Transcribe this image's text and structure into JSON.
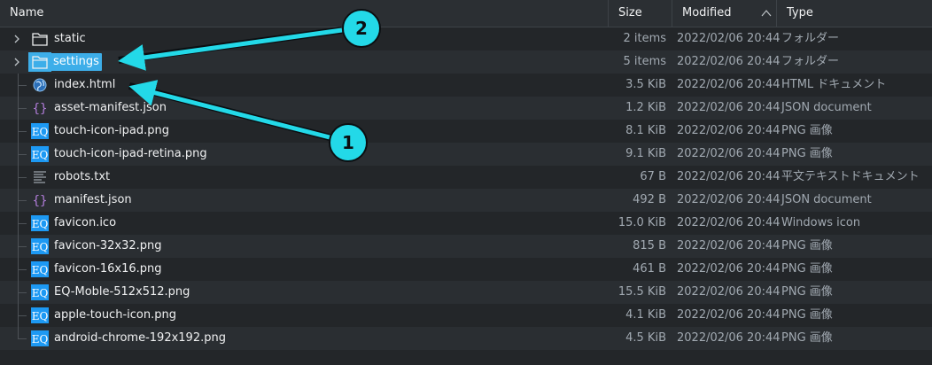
{
  "header": {
    "name": "Name",
    "size": "Size",
    "modified": "Modified",
    "type": "Type"
  },
  "files": [
    {
      "name": "static",
      "size": "2 items",
      "modified": "2022/02/06 20:44",
      "type": "フォルダー",
      "icon": "folder-icon",
      "expandable": true,
      "selected": false
    },
    {
      "name": "settings",
      "size": "5 items",
      "modified": "2022/02/06 20:44",
      "type": "フォルダー",
      "icon": "folder-icon",
      "expandable": true,
      "selected": true
    },
    {
      "name": "index.html",
      "size": "3.5 KiB",
      "modified": "2022/02/06 20:44",
      "type": "HTML ドキュメント",
      "icon": "globe-icon"
    },
    {
      "name": "asset-manifest.json",
      "size": "1.2 KiB",
      "modified": "2022/02/06 20:44",
      "type": "JSON document",
      "icon": "json-icon"
    },
    {
      "name": "touch-icon-ipad.png",
      "size": "8.1 KiB",
      "modified": "2022/02/06 20:44",
      "type": "PNG 画像",
      "icon": "eq-image-icon"
    },
    {
      "name": "touch-icon-ipad-retina.png",
      "size": "9.1 KiB",
      "modified": "2022/02/06 20:44",
      "type": "PNG 画像",
      "icon": "eq-image-icon"
    },
    {
      "name": "robots.txt",
      "size": "67 B",
      "modified": "2022/02/06 20:44",
      "type": "平文テキストドキュメント",
      "icon": "text-file-icon"
    },
    {
      "name": "manifest.json",
      "size": "492 B",
      "modified": "2022/02/06 20:44",
      "type": "JSON document",
      "icon": "json-icon"
    },
    {
      "name": "favicon.ico",
      "size": "15.0 KiB",
      "modified": "2022/02/06 20:44",
      "type": "Windows icon",
      "icon": "eq-image-icon"
    },
    {
      "name": "favicon-32x32.png",
      "size": "815 B",
      "modified": "2022/02/06 20:44",
      "type": "PNG 画像",
      "icon": "eq-image-icon"
    },
    {
      "name": "favicon-16x16.png",
      "size": "461 B",
      "modified": "2022/02/06 20:44",
      "type": "PNG 画像",
      "icon": "eq-image-icon"
    },
    {
      "name": "EQ-Moble-512x512.png",
      "size": "15.5 KiB",
      "modified": "2022/02/06 20:44",
      "type": "PNG 画像",
      "icon": "eq-image-icon"
    },
    {
      "name": "apple-touch-icon.png",
      "size": "4.1 KiB",
      "modified": "2022/02/06 20:44",
      "type": "PNG 画像",
      "icon": "eq-image-icon"
    },
    {
      "name": "android-chrome-192x192.png",
      "size": "4.5 KiB",
      "modified": "2022/02/06 20:44",
      "type": "PNG 画像",
      "icon": "eq-image-icon"
    }
  ],
  "icon_text": {
    "eq": "EQ"
  },
  "annotations": {
    "callout_1": "1",
    "callout_2": "2"
  },
  "colors": {
    "background": "#232629",
    "selection": "#3daee9",
    "callout": "#23d9e8",
    "json_braces": "#b07cd8"
  }
}
